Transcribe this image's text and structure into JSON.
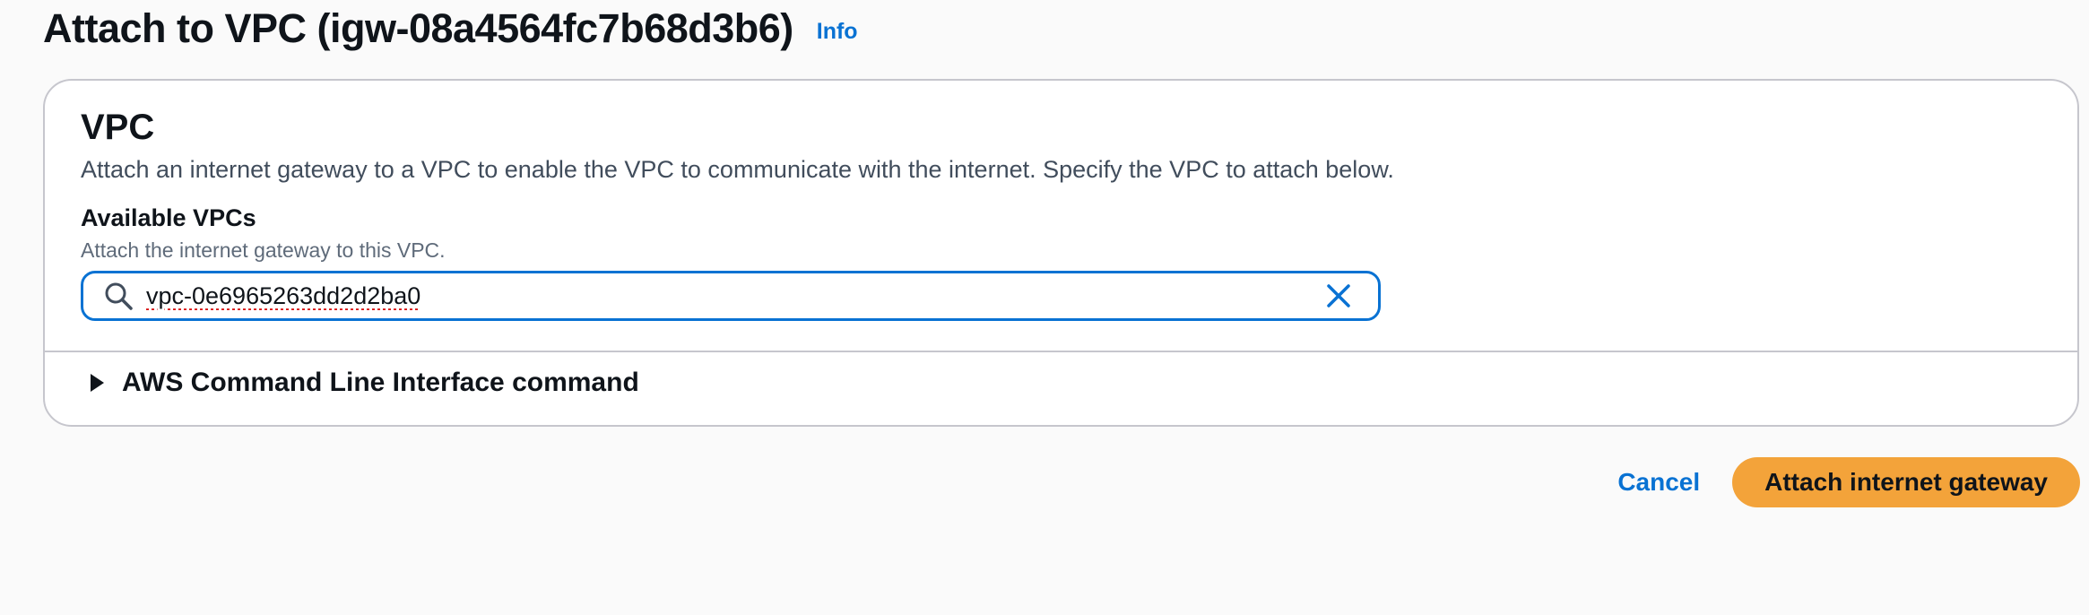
{
  "header": {
    "title": "Attach to VPC (igw-08a4564fc7b68d3b6)",
    "info_link": "Info"
  },
  "vpc_section": {
    "title": "VPC",
    "description": "Attach an internet gateway to a VPC to enable the VPC to communicate with the internet. Specify the VPC to attach below.",
    "available_vpcs": {
      "label": "Available VPCs",
      "description": "Attach the internet gateway to this VPC.",
      "value": "vpc-0e6965263dd2d2ba0",
      "icon": "search-icon",
      "clear_icon": "close-icon"
    }
  },
  "cli_expander": {
    "label": "AWS Command Line Interface command",
    "icon": "caret-right-icon"
  },
  "actions": {
    "cancel_label": "Cancel",
    "submit_label": "Attach internet gateway"
  },
  "colors": {
    "link": "#0972d3",
    "primary_button": "#f3a33a",
    "input_focus_border": "#0972d3"
  }
}
